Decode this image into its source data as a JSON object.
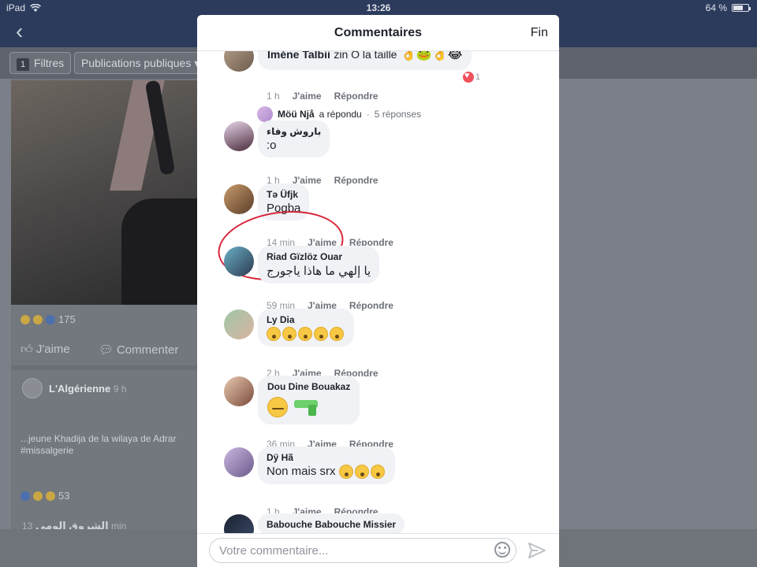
{
  "status_bar": {
    "device": "iPad",
    "time": "13:26",
    "battery": "64 %",
    "battery_level": 0.64
  },
  "background": {
    "filters": {
      "count": "1",
      "label": "Filtres"
    },
    "audience_label": "Publications publiques",
    "post1": {
      "reactions_count": "175",
      "like_label": "J'aime",
      "comment_label": "Commenter"
    },
    "post2": {
      "page_name": "L'Algérienne",
      "time": "9 h",
      "text_line1": "...jeune Khadija de la wilaya de Adrar",
      "text_line2": "#missalgerie",
      "reactions_count": "53"
    },
    "post3": {
      "page_name": "الشروق الومي",
      "time": "13 min"
    }
  },
  "modal": {
    "title": "Commentaires",
    "done_label": "Fin",
    "like_label": "J'aime",
    "reply_label": "Répondre",
    "comments": [
      {
        "author": "Iméne Talbii",
        "text": "zin O la taille",
        "time": "1 h",
        "reaction_count": "1"
      },
      {
        "author": "باروش وفاء",
        "text": ":o",
        "time": "1 h"
      },
      {
        "author": "Tə Üfjk",
        "text": "Pogba",
        "time": "14 min"
      },
      {
        "author": "Riad Gïzlöz Ouar",
        "text": "يا إلهي ما هاذا ياجورج",
        "time": "59 min"
      },
      {
        "author": "Ly Dia",
        "text": "",
        "time": "2 h"
      },
      {
        "author": "Dou Dine Bouakaz",
        "text": "",
        "time": "36 min"
      },
      {
        "author": "Dÿ Hã",
        "text": "Non mais srx",
        "time": "1 h"
      },
      {
        "author": "Babouche Babouche Missier",
        "text": "",
        "time": ""
      }
    ],
    "replies": {
      "author": "Möü Njå",
      "action": "a répondu",
      "separator": "·",
      "count": "5 réponses"
    },
    "composer_placeholder": "Votre commentaire..."
  },
  "colors": {
    "nav_bar": "#2c3b5c",
    "bubble": "#f0f2f5",
    "annotation": "#d8263a"
  }
}
